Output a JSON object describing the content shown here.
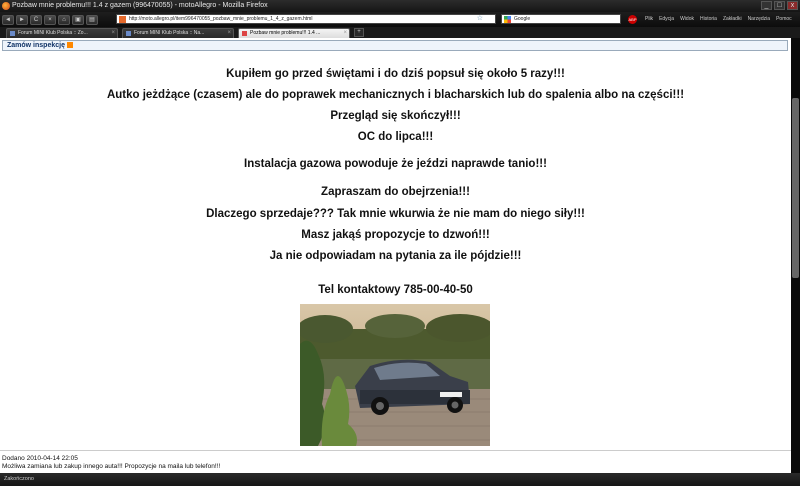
{
  "window": {
    "title": "Pozbaw mnie problemu!!! 1.4 z gazem (996470055) - motoAllegro - Mozilla Firefox",
    "minimize": "_",
    "maximize": "□",
    "close": "x"
  },
  "nav": {
    "back": "◄",
    "forward": "►",
    "reload": "C",
    "stop": "×",
    "home": "⌂",
    "url": "http://moto.allegro.pl/item996470055_pozbaw_mnie_problemu_1_4_z_gazem.html",
    "search_placeholder": "Google",
    "abp": "ABP"
  },
  "menu": [
    "Plik",
    "Edycja",
    "Widok",
    "Historia",
    "Zakładki",
    "Narzędzia",
    "Pomoc"
  ],
  "tabs": [
    {
      "label": "Forum MINI Klub Polska :: Zo..."
    },
    {
      "label": "Forum MINI Klub Polska :: Na..."
    },
    {
      "label": "Pozbaw mnie problemu!!! 1.4 ..."
    }
  ],
  "page": {
    "inspection": "Zamów inspekcję",
    "lines": [
      "Kupiłem go przed świętami i do dziś popsuł się około 5 razy!!!",
      "Autko jeżdżące (czasem) ale do poprawek mechanicznych i blacharskich lub do spalenia albo na części!!!",
      "Przegląd się skończył!!!",
      "OC do lipca!!!",
      "Instalacja gazowa powoduje że jeździ naprawde tanio!!!",
      "Zapraszam do obejrzenia!!!",
      "Dlaczego sprzedaje??? Tak mnie wkurwia że nie mam do niego siły!!!",
      "Masz jakąś propozycje to dzwoń!!!",
      "Ja nie odpowiadam na pytania za ile pójdzie!!!",
      "Tel kontaktowy 785-00-40-50"
    ],
    "added": "Dodano 2010-04-14 22:05",
    "note": "Możliwa zamiana lub zakup innego auta!!! Propozycje na maila lub telefon!!!"
  },
  "status": "Zakończono"
}
